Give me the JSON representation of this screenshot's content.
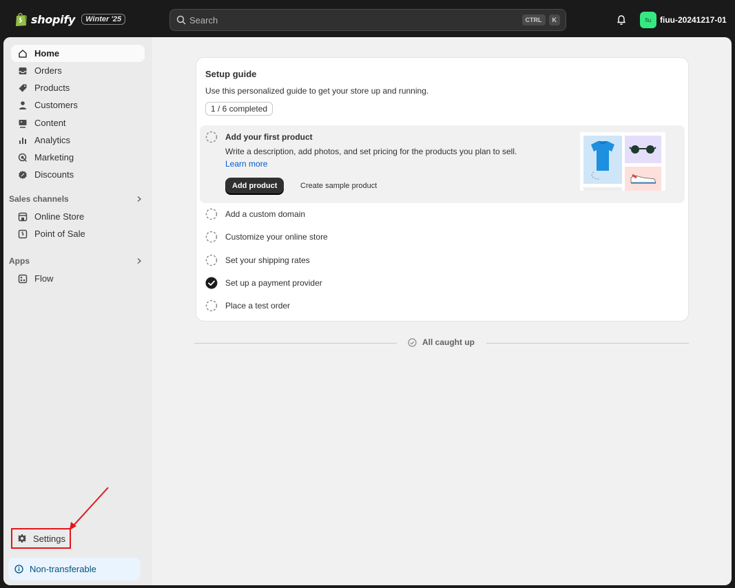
{
  "topbar": {
    "logo_text": "shopify",
    "edition_badge": "Winter '25",
    "search_placeholder": "Search",
    "shortcut_ctrl": "CTRL",
    "shortcut_key": "K",
    "avatar_initials": "fiu",
    "store_name": "fiuu-20241217-01"
  },
  "sidebar": {
    "items": [
      {
        "label": "Home",
        "icon": "home-icon",
        "active": true
      },
      {
        "label": "Orders",
        "icon": "inbox-icon"
      },
      {
        "label": "Products",
        "icon": "tag-icon"
      },
      {
        "label": "Customers",
        "icon": "person-icon"
      },
      {
        "label": "Content",
        "icon": "image-icon"
      },
      {
        "label": "Analytics",
        "icon": "bar-chart-icon"
      },
      {
        "label": "Marketing",
        "icon": "target-icon"
      },
      {
        "label": "Discounts",
        "icon": "discount-icon"
      }
    ],
    "sales_channels_label": "Sales channels",
    "sales_channels": [
      {
        "label": "Online Store",
        "icon": "storefront-icon"
      },
      {
        "label": "Point of Sale",
        "icon": "pos-icon"
      }
    ],
    "apps_label": "Apps",
    "apps": [
      {
        "label": "Flow",
        "icon": "flow-icon"
      }
    ],
    "settings_label": "Settings",
    "non_transferable_label": "Non-transferable"
  },
  "setup_guide": {
    "title": "Setup guide",
    "description": "Use this personalized guide to get your store up and running.",
    "progress": "1 / 6 completed",
    "expanded_task": {
      "title": "Add your first product",
      "body": "Write a description, add photos, and set pricing for the products you plan to sell.",
      "learn_more": "Learn more",
      "primary_button": "Add product",
      "secondary_button": "Create sample product"
    },
    "tasks": [
      {
        "label": "Add a custom domain",
        "done": false
      },
      {
        "label": "Customize your online store",
        "done": false
      },
      {
        "label": "Set your shipping rates",
        "done": false
      },
      {
        "label": "Set up a payment provider",
        "done": true
      },
      {
        "label": "Place a test order",
        "done": false
      }
    ]
  },
  "footer": {
    "all_caught_up": "All caught up"
  },
  "colors": {
    "topbar_bg": "#1a1a1a",
    "accent_green": "#36e882",
    "link_blue": "#005bd3",
    "highlight_red": "#e1161b"
  }
}
